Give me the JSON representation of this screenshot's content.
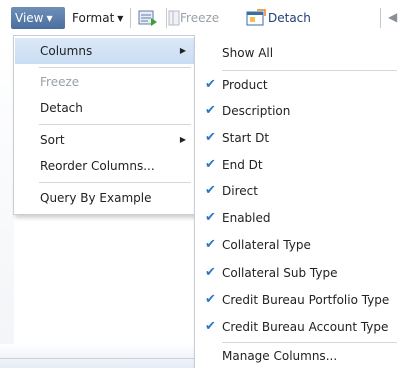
{
  "toolbar": {
    "view_label": "View",
    "format_label": "Format",
    "freeze_label": "Freeze",
    "detach_label": "Detach"
  },
  "menu": {
    "items": [
      {
        "label": "Columns",
        "has_submenu": true,
        "active": true
      },
      {
        "label": "Freeze",
        "disabled": true
      },
      {
        "label": "Detach"
      },
      {
        "label": "Sort",
        "has_submenu": true
      },
      {
        "label": "Reorder Columns..."
      },
      {
        "label": "Query By Example"
      }
    ]
  },
  "submenu": {
    "show_all_label": "Show All",
    "columns": [
      {
        "label": "Product",
        "checked": true
      },
      {
        "label": "Description",
        "checked": true
      },
      {
        "label": "Start Dt",
        "checked": true
      },
      {
        "label": "End Dt",
        "checked": true
      },
      {
        "label": "Direct",
        "checked": true
      },
      {
        "label": "Enabled",
        "checked": true
      },
      {
        "label": "Collateral Type",
        "checked": true
      },
      {
        "label": "Collateral Sub Type",
        "checked": true
      },
      {
        "label": "Credit Bureau Portfolio Type",
        "checked": true
      },
      {
        "label": "Credit Bureau Account Type",
        "checked": true
      }
    ],
    "manage_label": "Manage Columns..."
  },
  "colors": {
    "view_button": "#4a6f9f",
    "menu_highlight": "#c9ddf3",
    "check": "#2a78c8",
    "disabled_text": "#9aa0a6"
  }
}
